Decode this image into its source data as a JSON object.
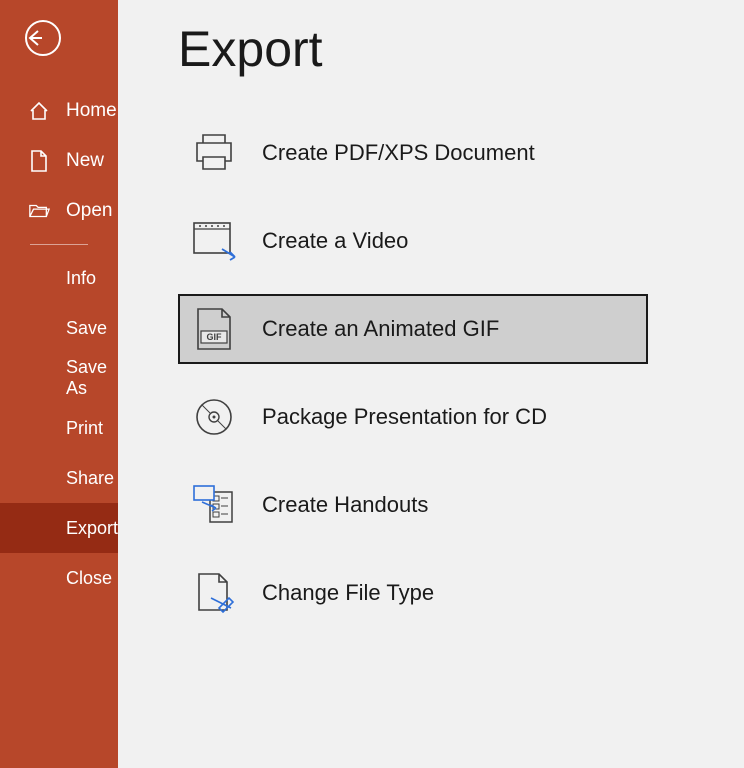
{
  "colors": {
    "sidebar_bg": "#b7472a",
    "sidebar_selected": "#952b14",
    "main_bg": "#f1f1f1",
    "option_selected_bg": "#cfcfcf",
    "text_dark": "#1a1a1a"
  },
  "page_title": "Export",
  "sidebar": {
    "primary": [
      {
        "label": "Home",
        "icon": "home-icon"
      },
      {
        "label": "New",
        "icon": "new-icon"
      },
      {
        "label": "Open",
        "icon": "open-icon"
      }
    ],
    "secondary": [
      {
        "label": "Info"
      },
      {
        "label": "Save"
      },
      {
        "label": "Save As"
      },
      {
        "label": "Print"
      },
      {
        "label": "Share"
      },
      {
        "label": "Export",
        "selected": true
      },
      {
        "label": "Close"
      }
    ]
  },
  "export_options": [
    {
      "label": "Create PDF/XPS Document",
      "icon": "printer-icon"
    },
    {
      "label": "Create a Video",
      "icon": "video-icon"
    },
    {
      "label": "Create an Animated GIF",
      "icon": "gif-icon",
      "selected": true
    },
    {
      "label": "Package Presentation for CD",
      "icon": "cd-icon"
    },
    {
      "label": "Create Handouts",
      "icon": "handouts-icon"
    },
    {
      "label": "Change File Type",
      "icon": "filetype-icon"
    }
  ]
}
